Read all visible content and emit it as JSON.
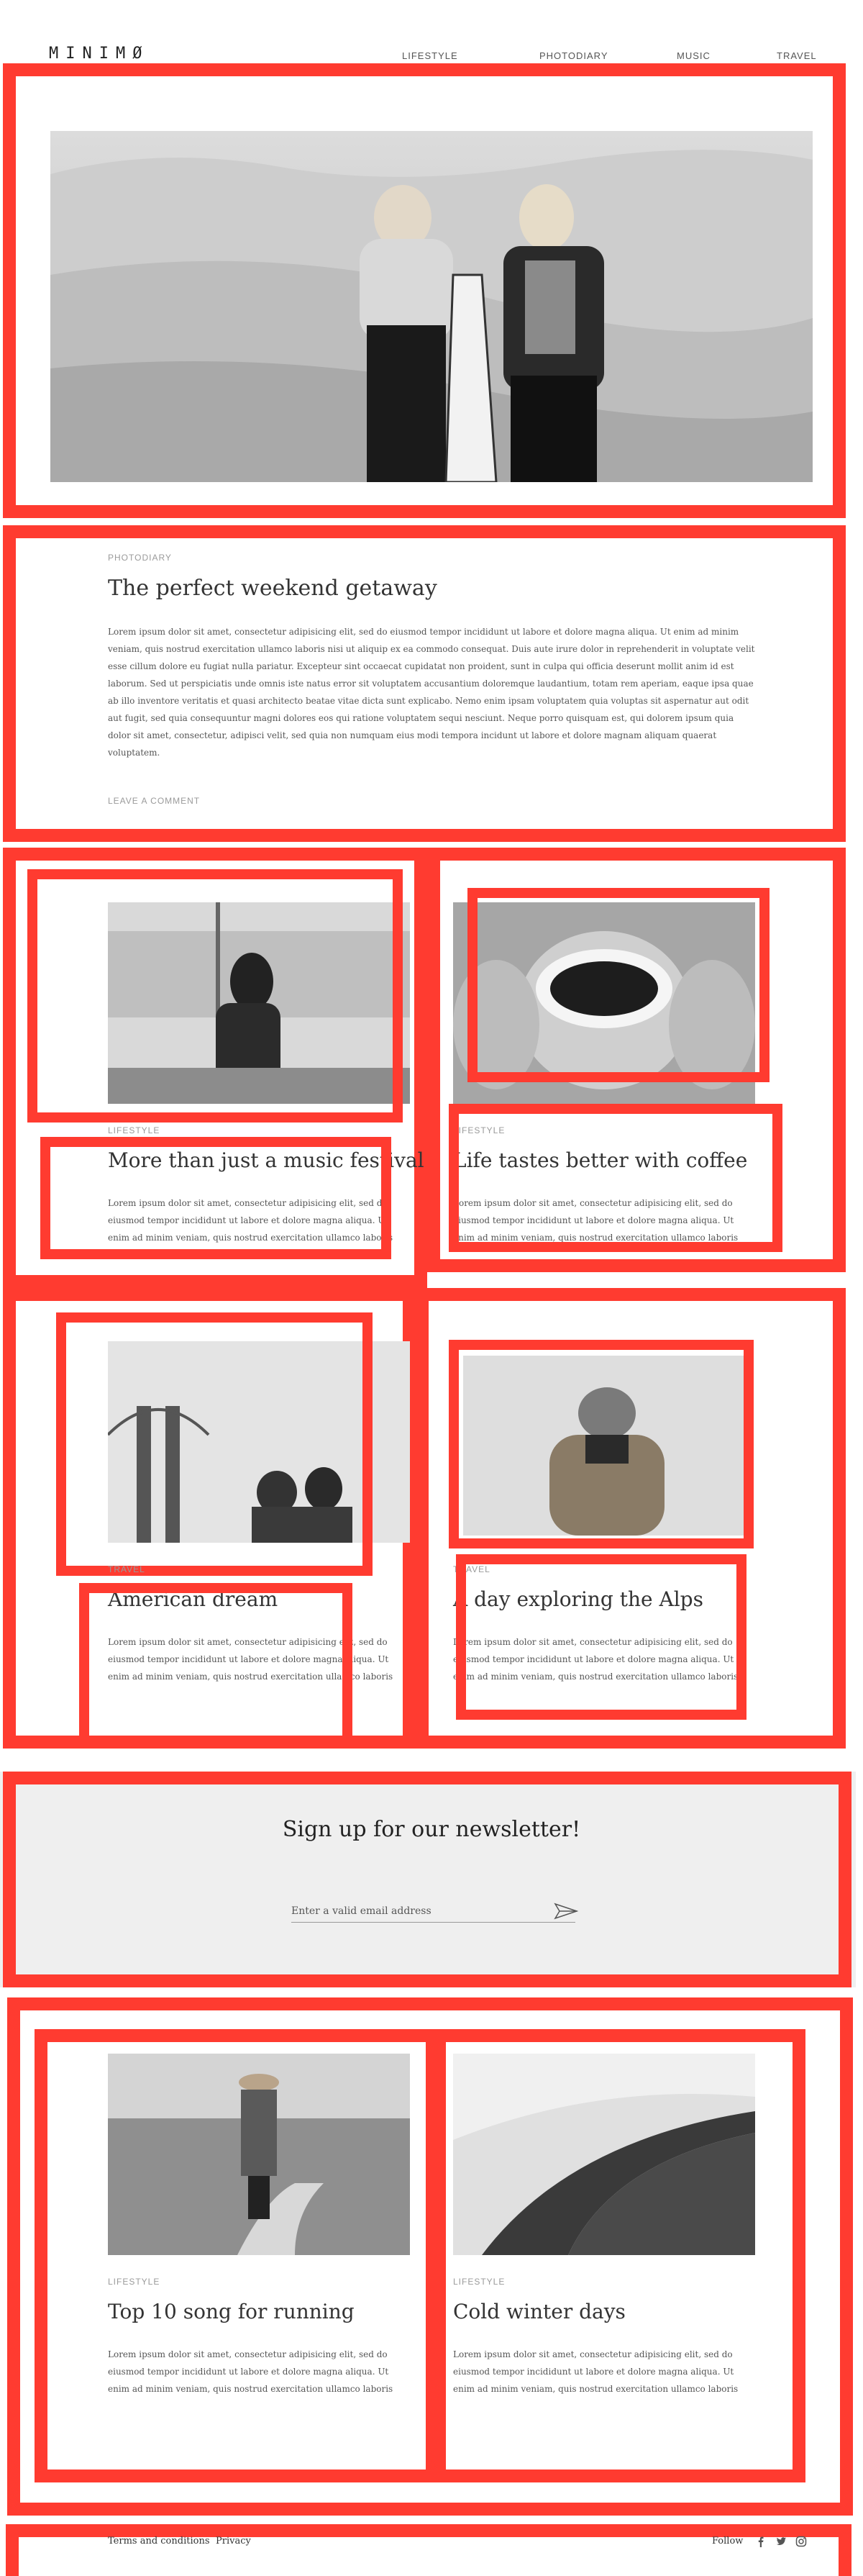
{
  "header": {
    "logo": "MINIMØ",
    "nav": [
      "LIFESTYLE",
      "PHOTODIARY",
      "MUSIC",
      "TRAVEL"
    ]
  },
  "featured": {
    "category": "PHOTODIARY",
    "title": "The perfect weekend getaway",
    "body": "Lorem ipsum dolor sit amet, consectetur adipisicing elit, sed do eiusmod tempor incididunt ut labore et dolore magna aliqua. Ut enim ad minim veniam, quis nostrud exercitation ullamco laboris nisi ut aliquip ex ea commodo consequat. Duis aute irure dolor in reprehenderit in voluptate velit esse cillum dolore eu fugiat nulla pariatur. Excepteur sint occaecat cupidatat non proident, sunt in culpa qui officia deserunt mollit anim id est laborum. Sed ut perspiciatis unde omnis iste natus error sit voluptatem accusantium doloremque laudantium, totam rem aperiam, eaque ipsa quae ab illo inventore veritatis et quasi architecto beatae vitae dicta sunt explicabo. Nemo enim ipsam voluptatem quia voluptas sit aspernatur aut odit aut fugit, sed quia consequuntur magni dolores eos qui ratione voluptatem sequi nesciunt. Neque porro quisquam est, qui dolorem ipsum quia dolor sit amet, consectetur, adipisci velit, sed quia non numquam eius modi tempora incidunt ut labore et dolore magnam aliquam quaerat voluptatem.",
    "comment": "LEAVE A COMMENT"
  },
  "posts": [
    {
      "category": "LIFESTYLE",
      "title": "More than just a music festival",
      "excerpt": "Lorem ipsum dolor sit amet, consectetur adipisicing elit, sed do eiusmod tempor incididunt ut labore et dolore magna aliqua. Ut enim ad minim veniam, quis nostrud exercitation ullamco laboris"
    },
    {
      "category": "LIFESTYLE",
      "title": "Life tastes better with coffee",
      "excerpt": "Lorem ipsum dolor sit amet, consectetur adipisicing elit, sed do eiusmod tempor incididunt ut labore et dolore magna aliqua. Ut enim ad minim veniam, quis nostrud exercitation ullamco laboris"
    },
    {
      "category": "TRAVEL",
      "title": "American dream",
      "excerpt": "Lorem ipsum dolor sit amet, consectetur adipisicing elit, sed do eiusmod tempor incididunt ut labore et dolore magna aliqua. Ut enim ad minim veniam, quis nostrud exercitation ullamco laboris"
    },
    {
      "category": "TRAVEL",
      "title": "A day exploring the Alps",
      "excerpt": "Lorem ipsum dolor sit amet, consectetur adipisicing elit, sed do eiusmod tempor incididunt ut labore et dolore magna aliqua. Ut enim ad minim veniam, quis nostrud exercitation ullamco laboris"
    },
    {
      "category": "LIFESTYLE",
      "title": "Top 10 song for running",
      "excerpt": "Lorem ipsum dolor sit amet, consectetur adipisicing elit, sed do eiusmod tempor incididunt ut labore et dolore magna aliqua. Ut enim ad minim veniam, quis nostrud exercitation ullamco laboris"
    },
    {
      "category": "LIFESTYLE",
      "title": "Cold winter days",
      "excerpt": "Lorem ipsum dolor sit amet, consectetur adipisicing elit, sed do eiusmod tempor incididunt ut labore et dolore magna aliqua. Ut enim ad minim veniam, quis nostrud exercitation ullamco laboris"
    }
  ],
  "newsletter": {
    "title": "Sign up for our newsletter!",
    "placeholder": "Enter a valid email address"
  },
  "footer": {
    "terms": "Terms and conditions",
    "privacy": "Privacy",
    "follow": "Follow"
  },
  "colors": {
    "annotation": "#ff3b30",
    "newsletter_bg": "#efefef",
    "text": "#333333",
    "muted": "#9a9a9a"
  }
}
